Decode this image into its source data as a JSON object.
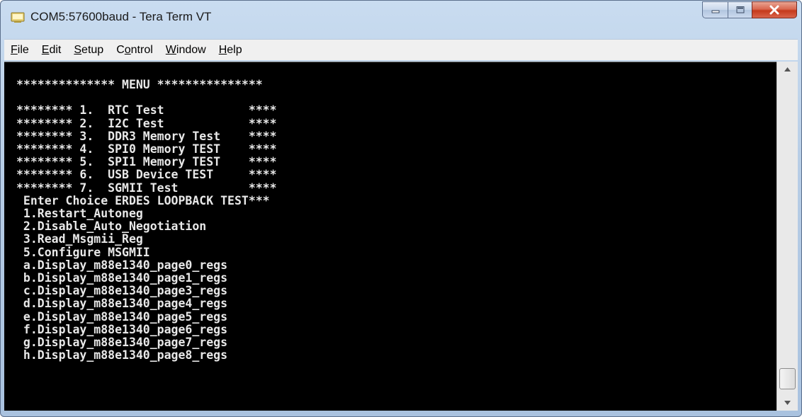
{
  "window": {
    "title": "COM5:57600baud - Tera Term VT"
  },
  "menu": {
    "items": [
      {
        "key": "F",
        "rest": "ile"
      },
      {
        "key": "E",
        "rest": "dit"
      },
      {
        "key": "S",
        "rest": "etup"
      },
      {
        "pre": "C",
        "key": "o",
        "rest": "ntrol"
      },
      {
        "key": "W",
        "rest": "indow"
      },
      {
        "key": "H",
        "rest": "elp"
      }
    ]
  },
  "terminal": {
    "lines": [
      "************** MENU ***************",
      "",
      "******** 1.  RTC Test            ****",
      "******** 2.  I2C Test            ****",
      "******** 3.  DDR3 Memory Test    ****",
      "******** 4.  SPI0 Memory TEST    ****",
      "******** 5.  SPI1 Memory TEST    ****",
      "******** 6.  USB Device TEST     ****",
      "******** 7.  SGMII Test          ****",
      " Enter Choice ERDES LOOPBACK TEST***",
      " 1.Restart_Autoneg",
      " 2.Disable_Auto_Negotiation",
      " 3.Read_Msgmii_Reg",
      " 5.Configure MSGMII",
      " a.Display_m88e1340_page0_regs",
      " b.Display_m88e1340_page1_regs",
      " c.Display_m88e1340_page3_regs",
      " d.Display_m88e1340_page4_regs",
      " e.Display_m88e1340_page5_regs",
      " f.Display_m88e1340_page6_regs",
      " g.Display_m88e1340_page7_regs",
      " h.Display_m88e1340_page8_regs"
    ]
  }
}
